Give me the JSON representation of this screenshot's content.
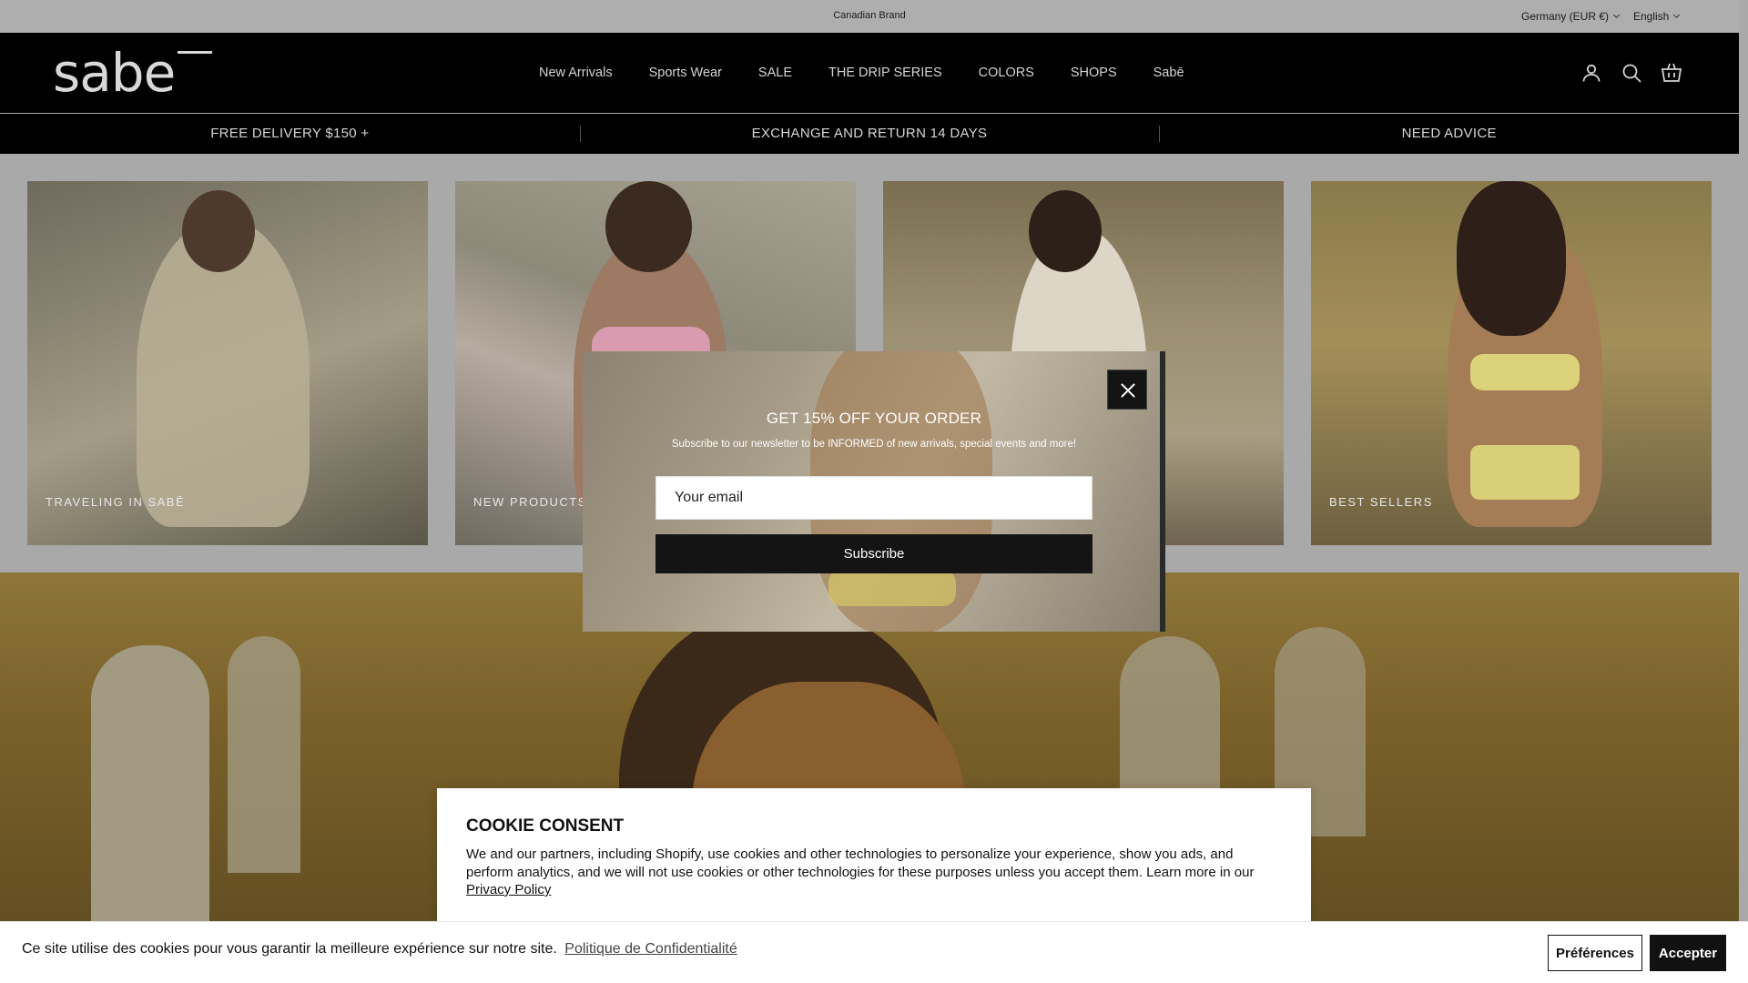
{
  "topbar": {
    "announcement": "Canadian Brand",
    "country": "Germany (EUR €)",
    "language": "English"
  },
  "header": {
    "logo": "sabe",
    "nav": [
      {
        "label": "New Arrivals"
      },
      {
        "label": "Sports Wear"
      },
      {
        "label": "SALE"
      },
      {
        "label": "THE DRIP SERIES"
      },
      {
        "label": "COLORS"
      },
      {
        "label": "SHOPS"
      },
      {
        "label": "Sabē"
      }
    ],
    "icons": [
      "account-icon",
      "search-icon",
      "cart-icon"
    ]
  },
  "usp": [
    "FREE DELIVERY $150 +",
    "EXCHANGE AND RETURN 14 DAYS",
    "NEED ADVICE"
  ],
  "tiles": [
    {
      "caption": "TRAVELING IN SABĒ"
    },
    {
      "caption": "NEW PRODUCTS"
    },
    {
      "caption": ""
    },
    {
      "caption": "BEST SELLERS"
    }
  ],
  "newsletter": {
    "title": "GET 15% OFF YOUR ORDER",
    "subtitle": "Subscribe to our newsletter to be INFORMED of new arrivals, special events and more!",
    "email_placeholder": "Your email",
    "subscribe_label": "Subscribe"
  },
  "consent": {
    "title": "COOKIE CONSENT",
    "body": "We and our partners, including Shopify, use cookies and other technologies to personalize your experience, show you ads, and perform analytics, and we will not use cookies or other technologies for these purposes unless you accept them. Learn more in our",
    "link": "Privacy Policy"
  },
  "banner": {
    "message": "Ce site utilise des cookies pour vous garantir la meilleure expérience sur notre site.",
    "link": "Politique de Confidentialité",
    "preferences_label": "Préférences",
    "accept_label": "Accepter"
  }
}
